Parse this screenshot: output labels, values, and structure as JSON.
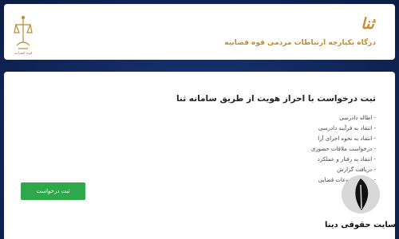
{
  "header": {
    "emblem_caption": "قوه قضاییه",
    "logo_text": "ثنا",
    "portal_title": "درگاه یکپارچه ارتباطات مردمی قوه قضاییه"
  },
  "main": {
    "title": "ثبت درخواست با احراز هویت از طریق سامانه ثنا",
    "options": [
      {
        "label": "- اطاله دادرسی"
      },
      {
        "label": "- انتقاد به فرآیند دادرسی"
      },
      {
        "label": "- انتقاد به نحوه اجرای آرا"
      },
      {
        "label": "- درخواست ملاقات حضوری"
      },
      {
        "label": "- انتقاد به رفتار و عملکرد"
      },
      {
        "label": "- دریافت گزارش"
      },
      {
        "label": "- سایر موضوعات قضایی"
      }
    ],
    "submit_label": "ثبت درخواست"
  },
  "watermark": {
    "text": "سایت حقوقی دینا",
    "icon": "quill-pen-icon"
  },
  "colors": {
    "background": "#132c66",
    "brand_gold": "#c98a2c",
    "button_green": "#2ea84a"
  }
}
